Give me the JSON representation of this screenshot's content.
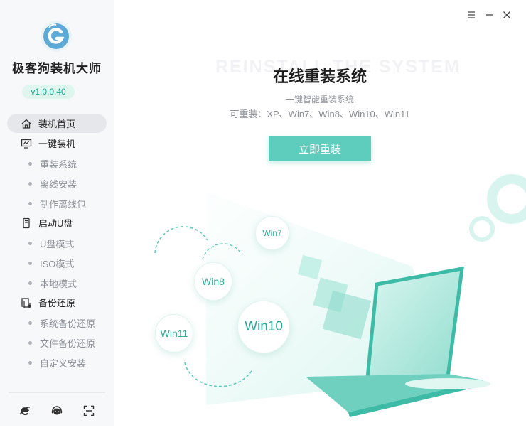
{
  "app": {
    "name": "极客狗装机大师",
    "version": "v1.0.0.40"
  },
  "sidebar": {
    "items": [
      {
        "label": "装机首页",
        "icon": "home-icon",
        "active": true
      },
      {
        "label": "一键装机",
        "icon": "monitor-icon"
      },
      {
        "label": "重装系统",
        "sub": true
      },
      {
        "label": "离线安装",
        "sub": true
      },
      {
        "label": "制作离线包",
        "sub": true
      },
      {
        "label": "启动U盘",
        "icon": "usb-drive-icon"
      },
      {
        "label": "U盘模式",
        "sub": true
      },
      {
        "label": "ISO模式",
        "sub": true
      },
      {
        "label": "本地模式",
        "sub": true
      },
      {
        "label": "备份还原",
        "icon": "backup-icon"
      },
      {
        "label": "系统备份还原",
        "sub": true
      },
      {
        "label": "文件备份还原",
        "sub": true
      },
      {
        "label": "自定义安装",
        "sub": true
      }
    ],
    "footer_icons": [
      "browser-icon",
      "chat-support-icon",
      "scan-icon"
    ]
  },
  "window_controls": [
    "menu-icon",
    "minimize-icon",
    "close-icon"
  ],
  "main": {
    "watermark": "REINSTALL THE SYSTEM",
    "title": "在线重装系统",
    "subtitle": "一键智能重装系统",
    "systems_line": "可重装：XP、Win7、Win8、Win10、Win11",
    "cta_label": "立即重装",
    "os_bubbles": [
      "Win7",
      "Win8",
      "Win10",
      "Win11"
    ]
  },
  "colors": {
    "accent": "#5ecdbd",
    "accent_dark": "#1aa38c",
    "sidebar_bg": "#f7f8f9"
  }
}
